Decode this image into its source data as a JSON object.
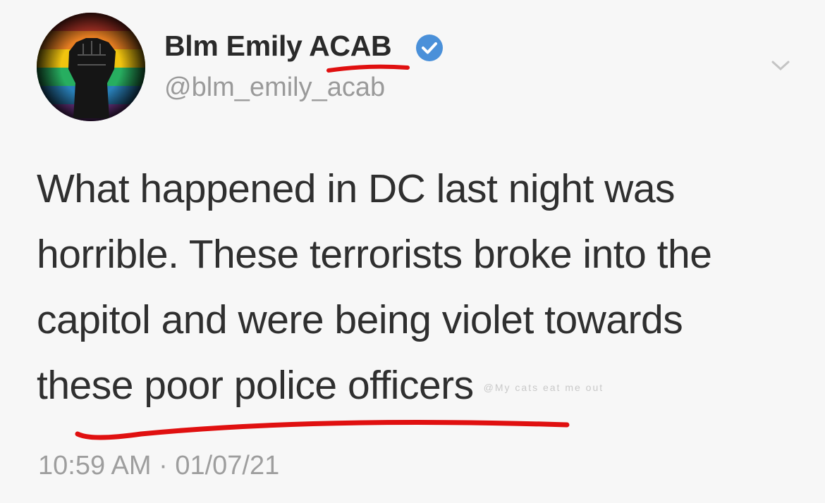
{
  "tweet": {
    "display_name": "Blm Emily ACAB",
    "handle": "@blm_emily_acab",
    "verified_icon": "verified-badge-icon",
    "menu_icon": "chevron-down-icon",
    "text_lines": [
      "What happened in DC last night was",
      "horrible. These terrorists broke into the",
      "capitol and were being violet towards",
      "these poor police officers"
    ],
    "faded_overlay_text": "@My cats eat me out",
    "timestamp": "10:59 AM · 01/07/21"
  },
  "colors": {
    "verified_blue": "#4a90d9",
    "annotation_red": "#e01010"
  }
}
